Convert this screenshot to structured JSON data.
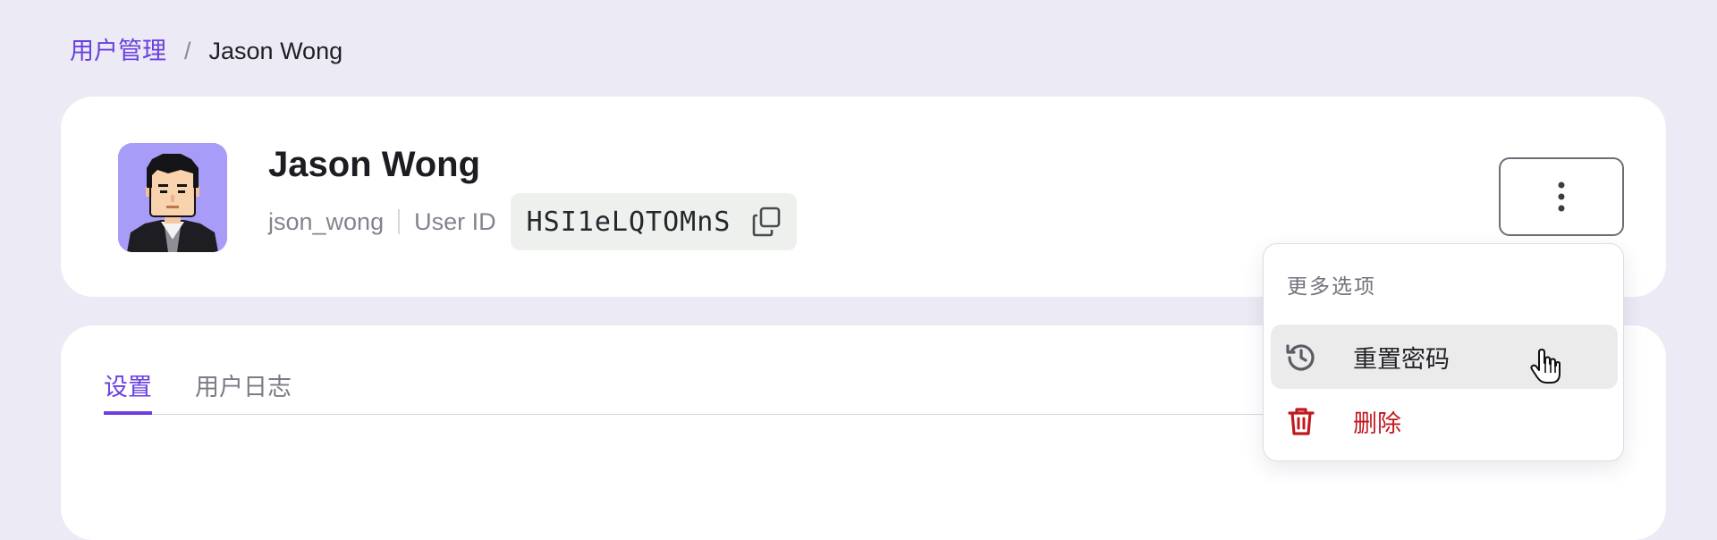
{
  "breadcrumb": {
    "parent": "用户管理",
    "separator": "/",
    "current": "Jason Wong"
  },
  "profile": {
    "name": "Jason Wong",
    "username": "json_wong",
    "user_id_label": "User ID",
    "user_id": "HSI1eLQTOMnS",
    "avatar_icon": "pixel-avatar",
    "copy_icon": "copy-icon",
    "more_icon": "vertical-dots-icon"
  },
  "tabs": [
    {
      "label": "设置",
      "active": true
    },
    {
      "label": "用户日志",
      "active": false
    }
  ],
  "menu": {
    "title": "更多选项",
    "items": [
      {
        "label": "重置密码",
        "icon": "history-icon",
        "color": "#232329"
      },
      {
        "label": "删除",
        "icon": "trash-icon",
        "color": "#c0191f"
      }
    ]
  },
  "colors": {
    "accent": "#6a3fe0",
    "danger": "#c0191f",
    "background": "#eceaf4"
  }
}
